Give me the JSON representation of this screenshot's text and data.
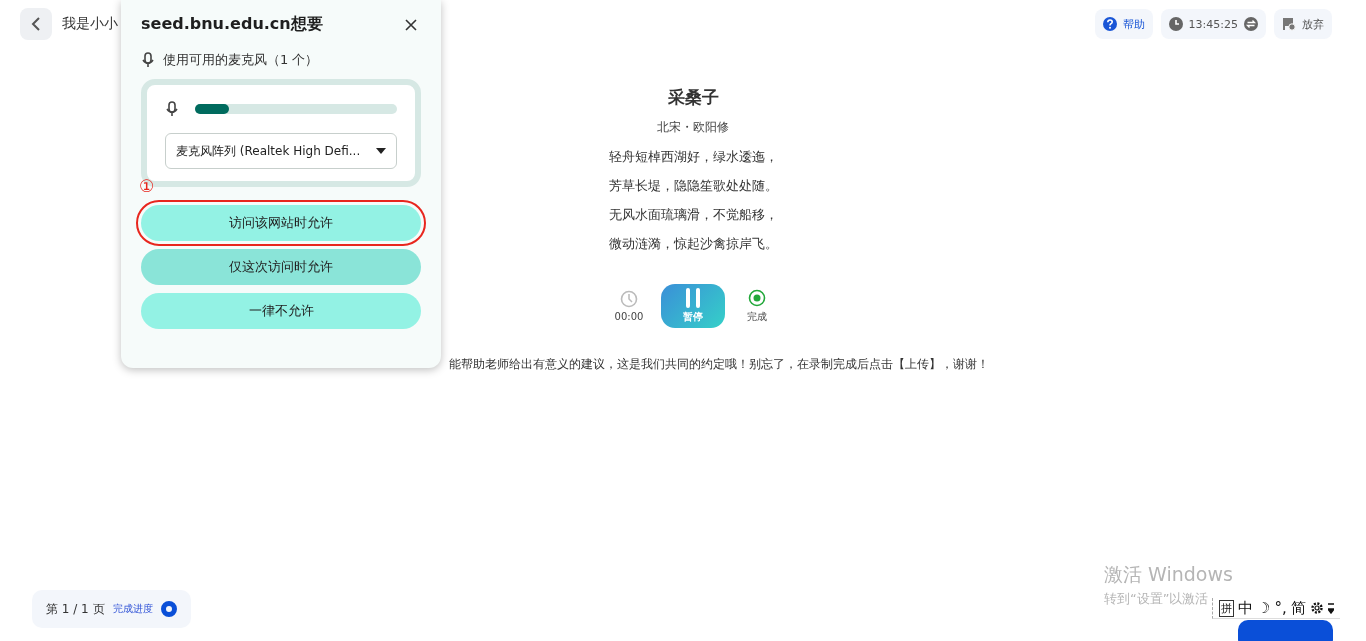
{
  "header": {
    "title": "我是小小",
    "actions": [
      {
        "kind": "help",
        "label": "帮助"
      },
      {
        "kind": "timer",
        "label": "13:45:25"
      },
      {
        "kind": "quit",
        "label": "放弃"
      }
    ]
  },
  "poem": {
    "title": "采桑子",
    "author": "北宋・欧阳修",
    "lines": [
      "轻舟短棹西湖好，绿水逶迤，",
      "芳草长堤，隐隐笙歌处处随。",
      "无风水面琉璃滑，不觉船移，",
      "微动涟漪，惊起沙禽掠岸飞。"
    ]
  },
  "recorder": {
    "elapsed": "00:00",
    "pause": "暂停",
    "finish": "完成"
  },
  "notice": "能帮助老师给出有意义的建议，这是我们共同的约定哦！别忘了，在录制完成后点击【上传】，谢谢！",
  "pager": {
    "page": "第 1 / 1 页",
    "progress": "完成进度"
  },
  "permission_popup": {
    "title": "seed.bnu.edu.cn想要",
    "request": "使用可用的麦克风（1 个）",
    "mic": {
      "level": 0.17,
      "device": "麦克风阵列 (Realtek High Defi..."
    },
    "annotation": "①",
    "buttons": [
      {
        "label": "访问该网站时允许",
        "hovered": false,
        "marked": true
      },
      {
        "label": "仅这次访问时允许",
        "hovered": true,
        "marked": false
      },
      {
        "label": "一律不允许",
        "hovered": false,
        "marked": false
      }
    ]
  },
  "windows_notice": {
    "title": "激活 Windows",
    "text": "转到“设置”以激活"
  },
  "ime_bar": [
    "拼",
    "中",
    "☽",
    "°,",
    "简"
  ]
}
